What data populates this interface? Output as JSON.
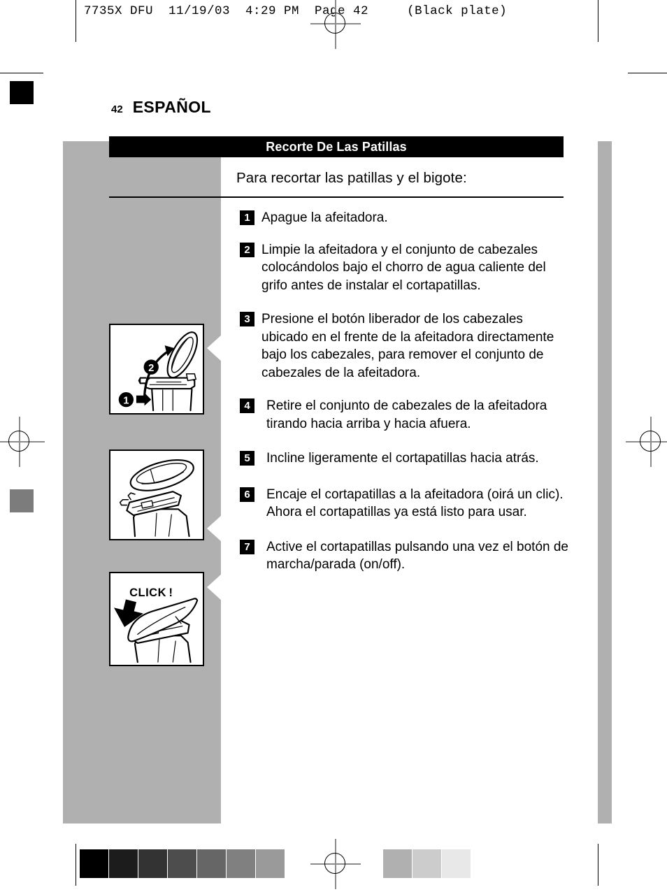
{
  "prepress": {
    "slug": "7735X DFU  11/19/03  4:29 PM  Page 42     (Black plate)",
    "registration_mark": "registration-target",
    "grayscale_strip": {
      "left_swatches": [
        "#000000",
        "#1c1c1c",
        "#333333",
        "#4d4d4d",
        "#666666",
        "#808080",
        "#9a9a9a"
      ],
      "right_swatches": [
        "#b0b0b0",
        "#cccccc",
        "#e8e8e8"
      ]
    },
    "corner_swatches": [
      "#000000",
      "#7c7c7c"
    ]
  },
  "page": {
    "number": "42",
    "language": "ESPAÑOL",
    "section_title": "Recorte De Las Patillas",
    "subtitle": "Para recortar las patillas y el bigote:",
    "accent_color": "#000000",
    "panel_color": "#b0b0b0"
  },
  "steps": [
    {
      "number": "1",
      "text": "Apague la afeitadora."
    },
    {
      "number": "2",
      "text": "Limpie la afeitadora y el conjunto de cabezales colocándolos bajo el chorro de agua caliente del grifo antes de instalar el cortapatillas."
    },
    {
      "number": "3",
      "text": "Presione el botón liberador de los cabezales ubicado en el frente de la afeitadora directamente bajo los cabezales, para remover el conjunto de cabezales de la afeitadora."
    },
    {
      "number": "4",
      "text": "Retire el conjunto de cabezales de la afeitadora tirando hacia arriba y hacia afuera."
    },
    {
      "number": "5",
      "text": "Incline ligeramente el cortapatillas hacia atrás."
    },
    {
      "number": "6",
      "text": "Encaje el cortapatillas a la afeitadora (oirá un clic). Ahora el cortapatillas ya está listo para usar."
    },
    {
      "number": "7",
      "text": "Active el cortapatillas pulsando una vez el botón de marcha/parada (on/off)."
    }
  ],
  "figures": [
    {
      "name": "figure-release-heads",
      "callouts": [
        "1",
        "2"
      ],
      "caption": ""
    },
    {
      "name": "figure-remove-head-assembly",
      "callouts": [],
      "caption": ""
    },
    {
      "name": "figure-click-trimmer",
      "callouts": [],
      "caption": "CLICK!"
    }
  ]
}
